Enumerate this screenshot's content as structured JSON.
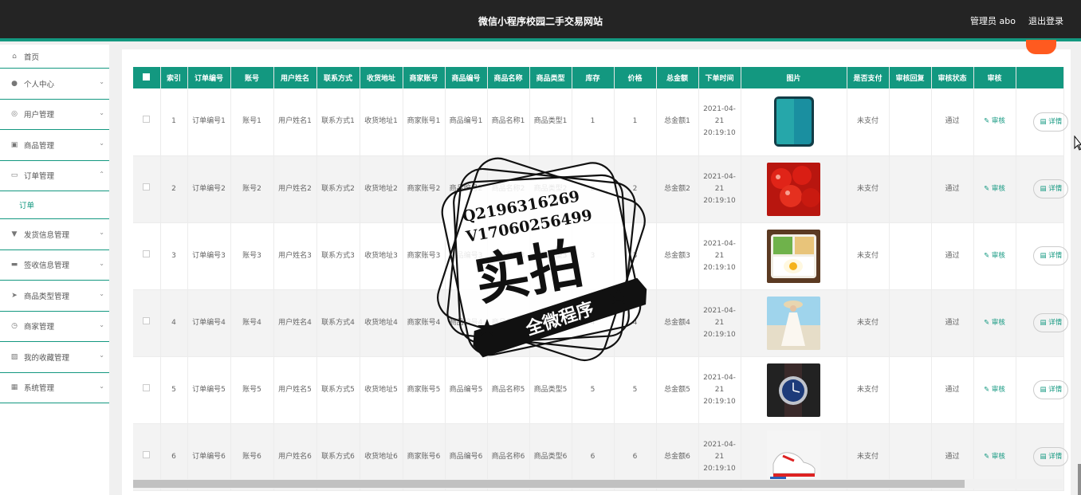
{
  "header": {
    "title": "微信小程序校园二手交易网站",
    "admin": "管理员 abo",
    "logout": "退出登录"
  },
  "sidebar": {
    "items": [
      {
        "label": "首页",
        "icon": "home-icon"
      },
      {
        "label": "个人中心",
        "icon": "user-icon"
      },
      {
        "label": "用户管理",
        "icon": "users-icon"
      },
      {
        "label": "商品管理",
        "icon": "box-icon"
      },
      {
        "label": "订单管理",
        "icon": "order-icon"
      },
      {
        "label": "发货信息管理",
        "icon": "truck-icon"
      },
      {
        "label": "签收信息管理",
        "icon": "monitor-icon"
      },
      {
        "label": "商品类型管理",
        "icon": "send-icon"
      },
      {
        "label": "商家管理",
        "icon": "clock-icon"
      },
      {
        "label": "我的收藏管理",
        "icon": "image-icon"
      },
      {
        "label": "系统管理",
        "icon": "grid-icon"
      }
    ],
    "active_sub": "订单"
  },
  "table": {
    "headers": [
      "索引",
      "订单编号",
      "账号",
      "用户姓名",
      "联系方式",
      "收货地址",
      "商家账号",
      "商品编号",
      "商品名称",
      "商品类型",
      "库存",
      "价格",
      "总金额",
      "下单时间",
      "图片",
      "是否支付",
      "审核回复",
      "审核状态",
      "审核"
    ],
    "rows": [
      {
        "idx": "1",
        "order": "订单编号1",
        "account": "账号1",
        "name": "用户姓名1",
        "phone": "联系方式1",
        "addr": "收货地址1",
        "merchant": "商家账号1",
        "code": "商品编号1",
        "pname": "商品名称1",
        "ptype": "商品类型1",
        "stock": "1",
        "price": "1",
        "total": "总金额1",
        "time": "2021-04-21 20:19:10",
        "img": "phone",
        "paid": "未支付",
        "reply": "",
        "status": "通过",
        "audit": "审核",
        "detail": "详情"
      },
      {
        "idx": "2",
        "order": "订单编号2",
        "account": "账号2",
        "name": "用户姓名2",
        "phone": "联系方式2",
        "addr": "收货地址2",
        "merchant": "商家账号2",
        "code": "商品编号2",
        "pname": "商品名称2",
        "ptype": "商品类型2",
        "stock": "2",
        "price": "2",
        "total": "总金额2",
        "time": "2021-04-21 20:19:10",
        "img": "cherry",
        "paid": "未支付",
        "reply": "",
        "status": "通过",
        "audit": "审核",
        "detail": "详情"
      },
      {
        "idx": "3",
        "order": "订单编号3",
        "account": "账号3",
        "name": "用户姓名3",
        "phone": "联系方式3",
        "addr": "收货地址3",
        "merchant": "商家账号3",
        "code": "商品编号3",
        "pname": "商品名称3",
        "ptype": "商品类型3",
        "stock": "3",
        "price": "3",
        "total": "总金额3",
        "time": "2021-04-21 20:19:10",
        "img": "food",
        "paid": "未支付",
        "reply": "",
        "status": "通过",
        "audit": "审核",
        "detail": "详情"
      },
      {
        "idx": "4",
        "order": "订单编号4",
        "account": "账号4",
        "name": "用户姓名4",
        "phone": "联系方式4",
        "addr": "收货地址4",
        "merchant": "商家账号4",
        "code": "商品编号4",
        "pname": "商品名称4",
        "ptype": "商品类型4",
        "stock": "4",
        "price": "4",
        "total": "总金额4",
        "time": "2021-04-21 20:19:10",
        "img": "dress",
        "paid": "未支付",
        "reply": "",
        "status": "通过",
        "audit": "审核",
        "detail": "详情"
      },
      {
        "idx": "5",
        "order": "订单编号5",
        "account": "账号5",
        "name": "用户姓名5",
        "phone": "联系方式5",
        "addr": "收货地址5",
        "merchant": "商家账号5",
        "code": "商品编号5",
        "pname": "商品名称5",
        "ptype": "商品类型5",
        "stock": "5",
        "price": "5",
        "total": "总金额5",
        "time": "2021-04-21 20:19:10",
        "img": "watch",
        "paid": "未支付",
        "reply": "",
        "status": "通过",
        "audit": "审核",
        "detail": "详情"
      },
      {
        "idx": "6",
        "order": "订单编号6",
        "account": "账号6",
        "name": "用户姓名6",
        "phone": "联系方式6",
        "addr": "收货地址6",
        "merchant": "商家账号6",
        "code": "商品编号6",
        "pname": "商品名称6",
        "ptype": "商品类型6",
        "stock": "6",
        "price": "6",
        "total": "总金额6",
        "time": "2021-04-21 20:19:10",
        "img": "shoe",
        "paid": "未支付",
        "reply": "",
        "status": "通过",
        "audit": "审核",
        "detail": "详情"
      }
    ]
  },
  "watermark": {
    "qq": "Q2196316269",
    "v": "V17060256499",
    "big": "实拍",
    "ribbon": "全微程序"
  },
  "colors": {
    "accent": "#139880",
    "topbar": "#242424",
    "orange": "#ff5a1f"
  }
}
